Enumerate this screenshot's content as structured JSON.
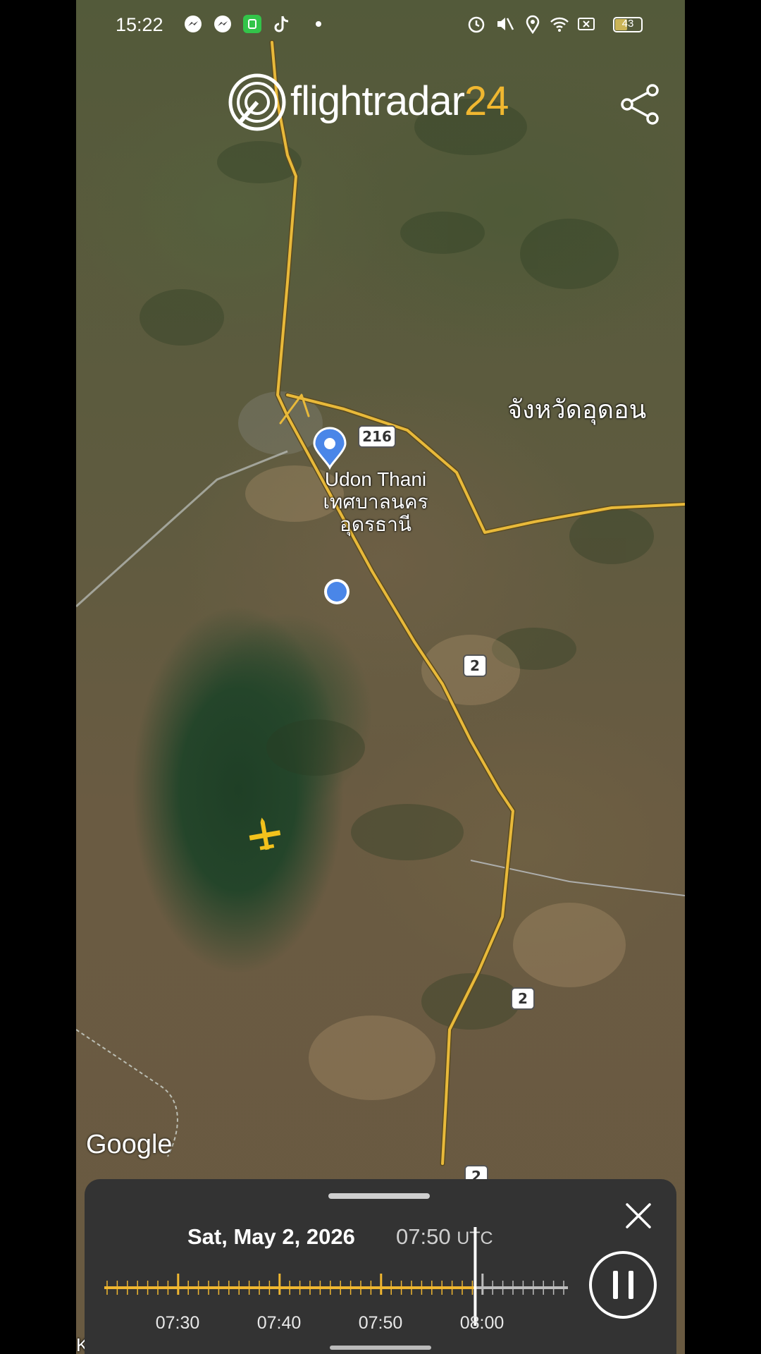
{
  "status_bar": {
    "time": "15:22",
    "left_icons": [
      "messenger-icon",
      "messenger-icon",
      "app-icon",
      "tiktok-icon",
      "dot-icon"
    ],
    "right_icons": [
      "alarm-icon",
      "mute-icon",
      "location-icon",
      "wifi-icon",
      "sim-off-icon",
      "battery-icon"
    ],
    "battery": "43"
  },
  "header": {
    "logo_text": "flightradar",
    "logo_number": "24",
    "brand_color": "#f0b730",
    "share_icon": "share-icon"
  },
  "map": {
    "region_label": "จังหวัดอุดอน",
    "city_en": "Udon Thani",
    "city_th_1": "เทศบาลนคร",
    "city_th_2": "อุดรธานี",
    "road_216": "216",
    "road_2_a": "2",
    "road_2_b": "2",
    "road_2_c": "2",
    "attribution": "Google",
    "bottom_label": "Kham",
    "road_color": "#e8b93a",
    "aircraft_color": "#f3c21c",
    "pin_color": "#4a86e8"
  },
  "playback": {
    "date": "Sat, May 2, 2026",
    "time": "07:50",
    "tz": "UTC",
    "progress": 0.8,
    "ticks": [
      "07:30",
      "07:40",
      "07:50",
      "08:00"
    ],
    "close_icon": "close-icon",
    "pause_icon": "pause-icon"
  }
}
